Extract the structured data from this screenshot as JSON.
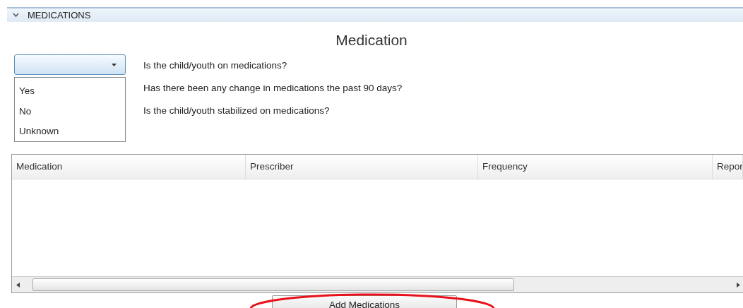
{
  "section": {
    "title": "MEDICATIONS",
    "expanded": true
  },
  "heading": "Medication",
  "dropdown": {
    "expanded": true,
    "options": [
      {
        "label": "Yes",
        "selected": false
      },
      {
        "label": "No",
        "selected": false
      },
      {
        "label": "Unknown",
        "selected": false
      }
    ]
  },
  "questions": [
    "Is the child/youth on medications?",
    "Has there been any change in medications the past 90 days?",
    "Is the child/youth stabilized on medications?"
  ],
  "table": {
    "columns": [
      "Medication",
      "Prescriber",
      "Frequency",
      "Repor"
    ]
  },
  "add_button": "Add Medications"
}
